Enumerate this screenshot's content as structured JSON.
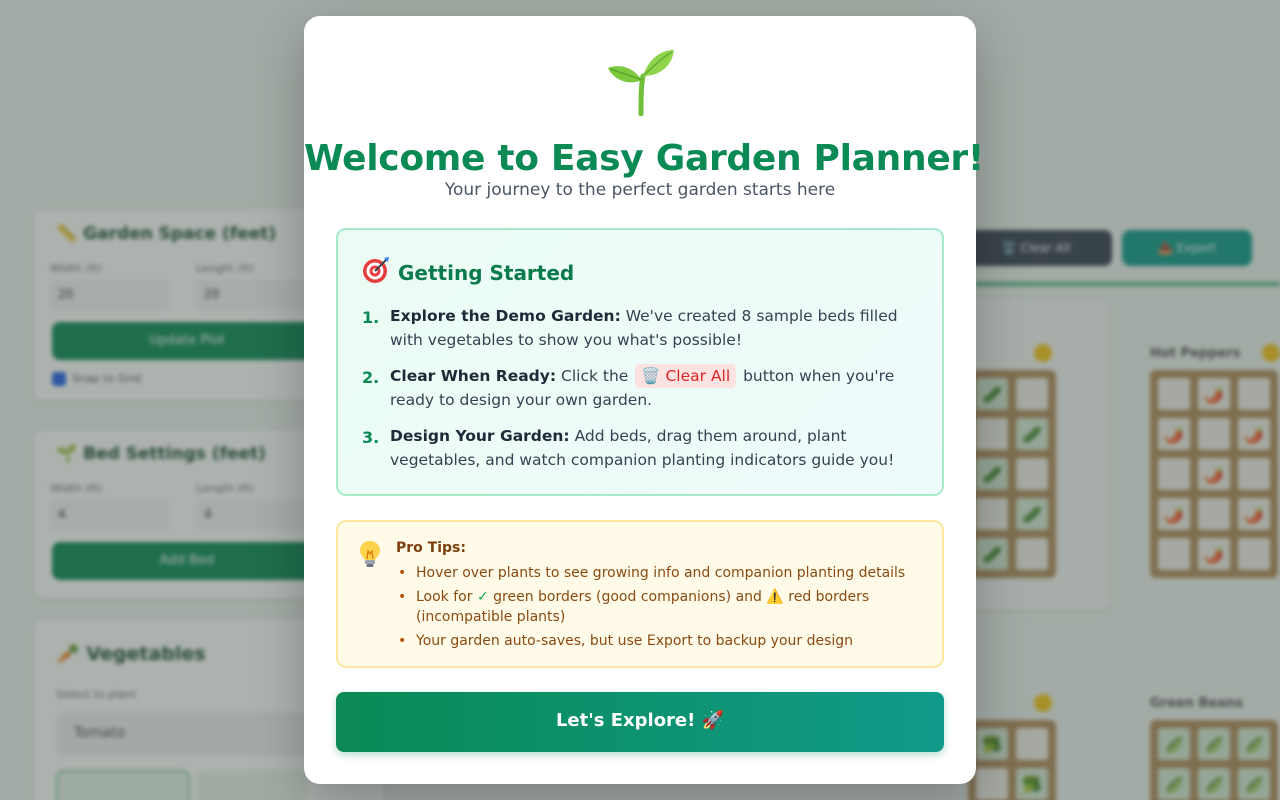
{
  "background": {
    "garden_space": {
      "title": "📏 Garden Space (feet)",
      "width_label": "Width (ft)",
      "length_label": "Length (ft)",
      "width_value": "20",
      "length_value": "20",
      "update_button": "Update Plot",
      "snap_label": "Snap to Grid"
    },
    "bed_settings": {
      "title": "🌱 Bed Settings (feet)",
      "width_label": "Width (ft)",
      "length_label": "Length (ft)",
      "width_value": "4",
      "length_value": "4",
      "add_button": "Add Bed"
    },
    "vegetables": {
      "title": "🥕 Vegetables",
      "select_label": "Select to plant",
      "select_value": "Tomato"
    },
    "toolbar": {
      "clear_button": "🗑️ Clear All",
      "export_button": "📤 Export"
    },
    "beds": [
      {
        "name": "Hot Peppers"
      },
      {
        "name": "Green Beans"
      }
    ]
  },
  "modal": {
    "title": "Welcome to Easy Garden Planner!",
    "subtitle": "Your journey to the perfect garden starts here",
    "getting_started": {
      "heading": "Getting Started",
      "steps": [
        {
          "number": "1.",
          "title": "Explore the Demo Garden:",
          "text": " We've created 8 sample beds filled with vegetables to show you what's possible!"
        },
        {
          "number": "2.",
          "title": "Clear When Ready:",
          "text_before": " Click the ",
          "chip": "🗑️ Clear All",
          "text_after": " button when you're ready to design your own garden."
        },
        {
          "number": "3.",
          "title": "Design Your Garden:",
          "text": " Add beds, drag them around, plant vegetables, and watch companion planting indicators guide you!"
        }
      ]
    },
    "pro_tips": {
      "heading": "Pro Tips:",
      "tips": [
        "Hover over plants to see growing info and companion planting details",
        {
          "before": "Look for ",
          "check": "✓",
          "middle": " green borders (good companions) and ",
          "warn": "⚠️",
          "after": " red borders (incompatible plants)"
        },
        "Your garden auto-saves, but use Export to backup your design"
      ]
    },
    "button_label": "Let's Explore! 🚀"
  }
}
